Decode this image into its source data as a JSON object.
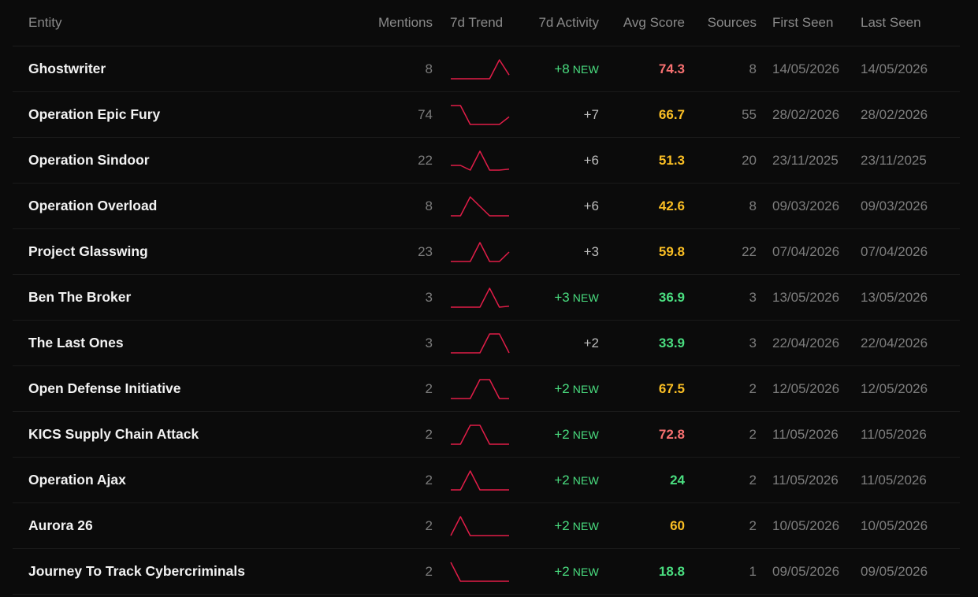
{
  "table": {
    "columns": {
      "entity": "Entity",
      "mentions": "Mentions",
      "trend": "7d Trend",
      "activity": "7d Activity",
      "score": "Avg Score",
      "sources": "Sources",
      "first_seen": "First Seen",
      "last_seen": "Last Seen"
    },
    "new_label": "NEW",
    "colors": {
      "score_high": "#f87171",
      "score_mid": "#fbbf24",
      "score_low": "#4ade80",
      "trend_line": "#e11d48",
      "positive": "#4ade80"
    },
    "rows": [
      {
        "entity": "Ghostwriter",
        "mentions": "8",
        "trend": [
          0,
          0,
          0,
          0,
          0,
          1,
          0.2
        ],
        "activity": "+8",
        "is_new": true,
        "score": "74.3",
        "score_level": "high",
        "sources": "8",
        "first_seen": "14/05/2026",
        "last_seen": "14/05/2026"
      },
      {
        "entity": "Operation Epic Fury",
        "mentions": "74",
        "trend": [
          1,
          1,
          0,
          0,
          0,
          0,
          0.4
        ],
        "activity": "+7",
        "is_new": false,
        "score": "66.7",
        "score_level": "mid",
        "sources": "55",
        "first_seen": "28/02/2026",
        "last_seen": "28/02/2026"
      },
      {
        "entity": "Operation Sindoor",
        "mentions": "22",
        "trend": [
          0.25,
          0.25,
          0,
          1,
          0,
          0,
          0.05
        ],
        "activity": "+6",
        "is_new": false,
        "score": "51.3",
        "score_level": "mid",
        "sources": "20",
        "first_seen": "23/11/2025",
        "last_seen": "23/11/2025"
      },
      {
        "entity": "Operation Overload",
        "mentions": "8",
        "trend": [
          0,
          0,
          1,
          0.5,
          0,
          0,
          0
        ],
        "activity": "+6",
        "is_new": false,
        "score": "42.6",
        "score_level": "mid",
        "sources": "8",
        "first_seen": "09/03/2026",
        "last_seen": "09/03/2026"
      },
      {
        "entity": "Project Glasswing",
        "mentions": "23",
        "trend": [
          0,
          0,
          0,
          1,
          0,
          0,
          0.5
        ],
        "activity": "+3",
        "is_new": false,
        "score": "59.8",
        "score_level": "mid",
        "sources": "22",
        "first_seen": "07/04/2026",
        "last_seen": "07/04/2026"
      },
      {
        "entity": "Ben The Broker",
        "mentions": "3",
        "trend": [
          0,
          0,
          0,
          0,
          1,
          0,
          0.05
        ],
        "activity": "+3",
        "is_new": true,
        "score": "36.9",
        "score_level": "low",
        "sources": "3",
        "first_seen": "13/05/2026",
        "last_seen": "13/05/2026"
      },
      {
        "entity": "The Last Ones",
        "mentions": "3",
        "trend": [
          0,
          0,
          0,
          0,
          1,
          1,
          0
        ],
        "activity": "+2",
        "is_new": false,
        "score": "33.9",
        "score_level": "low",
        "sources": "3",
        "first_seen": "22/04/2026",
        "last_seen": "22/04/2026"
      },
      {
        "entity": "Open Defense Initiative",
        "mentions": "2",
        "trend": [
          0,
          0,
          0,
          1,
          1,
          0,
          0
        ],
        "activity": "+2",
        "is_new": true,
        "score": "67.5",
        "score_level": "mid",
        "sources": "2",
        "first_seen": "12/05/2026",
        "last_seen": "12/05/2026"
      },
      {
        "entity": "KICS Supply Chain Attack",
        "mentions": "2",
        "trend": [
          0,
          0,
          1,
          1,
          0,
          0,
          0
        ],
        "activity": "+2",
        "is_new": true,
        "score": "72.8",
        "score_level": "high",
        "sources": "2",
        "first_seen": "11/05/2026",
        "last_seen": "11/05/2026"
      },
      {
        "entity": "Operation Ajax",
        "mentions": "2",
        "trend": [
          0,
          0,
          1,
          0,
          0,
          0,
          0
        ],
        "activity": "+2",
        "is_new": true,
        "score": "24",
        "score_level": "low",
        "sources": "2",
        "first_seen": "11/05/2026",
        "last_seen": "11/05/2026"
      },
      {
        "entity": "Aurora 26",
        "mentions": "2",
        "trend": [
          0,
          1,
          0,
          0,
          0,
          0,
          0
        ],
        "activity": "+2",
        "is_new": true,
        "score": "60",
        "score_level": "mid",
        "sources": "2",
        "first_seen": "10/05/2026",
        "last_seen": "10/05/2026"
      },
      {
        "entity": "Journey To Track Cybercriminals",
        "mentions": "2",
        "trend": [
          1,
          0,
          0,
          0,
          0,
          0,
          0
        ],
        "activity": "+2",
        "is_new": true,
        "score": "18.8",
        "score_level": "low",
        "sources": "1",
        "first_seen": "09/05/2026",
        "last_seen": "09/05/2026"
      }
    ]
  }
}
